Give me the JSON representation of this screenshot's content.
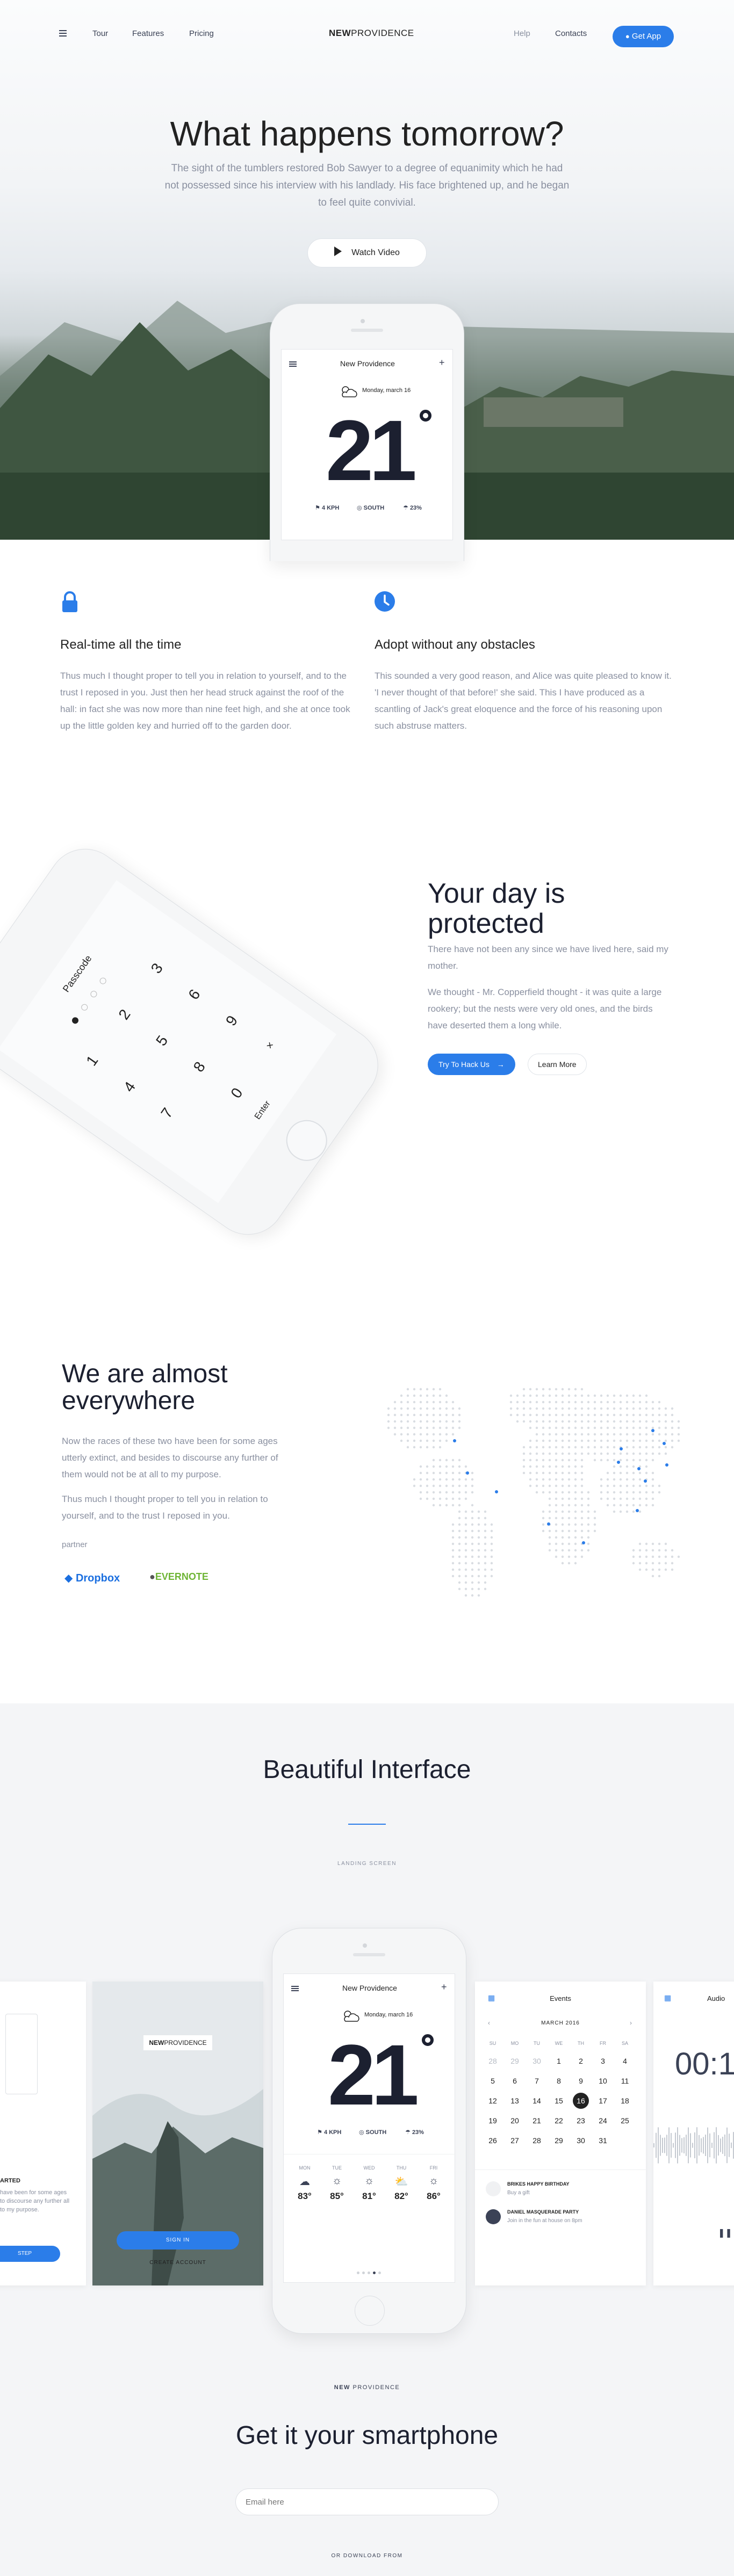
{
  "nav": {
    "menu_icon": "hamburger-icon",
    "links": [
      "Tour",
      "Features",
      "Pricing"
    ],
    "logo_bold": "NEW",
    "logo_light": "PROVIDENCE",
    "help": "Help",
    "contacts": "Contacts",
    "get_app": "Get App",
    "get_app_icon": "apple-icon"
  },
  "hero": {
    "title": "What happens tomorrow?",
    "subtitle": "The sight of the tumblers restored Bob Sawyer to a degree of equanimity which he had not possessed since his interview with his landlady. His face brightened up, and he began to feel quite convivial.",
    "watch_video": "Watch Video"
  },
  "weather": {
    "city": "New Providence",
    "date": "Monday, march 16",
    "temp": "21",
    "wind": "4 KPH",
    "direction": "SOUTH",
    "humidity": "23%",
    "days": [
      "MON",
      "TUE",
      "WED",
      "THU",
      "FRI"
    ],
    "temps": [
      "83°",
      "85°",
      "81°",
      "82°",
      "86°"
    ]
  },
  "features": [
    {
      "icon": "lock-icon",
      "title": "Real-time all the time",
      "text": "Thus much I thought proper to tell you in relation to yourself, and to the trust I reposed in you. Just then her head struck against the roof of the hall: in fact she was now more than nine feet high, and she at once took up the little golden key and hurried off to the garden door."
    },
    {
      "icon": "clock-icon",
      "title": "Adopt without any obstacles",
      "text": "This sounded a very good reason, and Alice was quite pleased to know it. 'I never thought of that before!' she said. This I have produced as a scantling of Jack's great eloquence and the force of his reasoning upon such abstruse matters."
    }
  ],
  "protected": {
    "title_line1": "Your day is",
    "title_line2": "protected",
    "p1": "There have not been any since we have lived here, said my mother.",
    "p2": "We thought - Mr. Copperfield thought - it was quite a large rookery; but the nests were very old ones, and the birds have deserted them a long while.",
    "try_button": "Try To Hack Us",
    "learn_button": "Learn More",
    "passcode_label": "Passcode",
    "keys": [
      "1",
      "2",
      "3",
      "4",
      "5",
      "6",
      "7",
      "8",
      "9",
      "0"
    ],
    "enter": "Enter"
  },
  "everywhere": {
    "title_line1": "We are almost",
    "title_line2": "everywhere",
    "p1": "Now the races of these two have been for some ages utterly extinct, and besides to discourse any further of them would not be at all to my purpose.",
    "p2": "Thus much I thought proper to tell you in relation to yourself, and to the trust I reposed in you.",
    "partner_label": "partner",
    "partners": [
      "Dropbox",
      "EVERNOTE"
    ]
  },
  "interface": {
    "title": "Beautiful Interface",
    "subtitle": "LANDING SCREEN",
    "signin": "SIGN IN",
    "create_account": "CREATE ACCOUNT",
    "start_title": "ARTED",
    "start_text": "have been for some ages to discourse any further all to my purpose.",
    "start_btn": "STEP",
    "events_title": "Events",
    "calendar_month": "MARCH 2016",
    "weekdays": [
      "SU",
      "MO",
      "TU",
      "WE",
      "TH",
      "FR",
      "SA"
    ],
    "calendar_days": [
      "28",
      "29",
      "30",
      "1",
      "2",
      "3",
      "4",
      "5",
      "6",
      "7",
      "8",
      "9",
      "10",
      "11",
      "12",
      "13",
      "14",
      "15",
      "16",
      "17",
      "18",
      "19",
      "20",
      "21",
      "22",
      "23",
      "24",
      "25",
      "26",
      "27",
      "28",
      "29",
      "30",
      "31"
    ],
    "selected_day": "16",
    "event1_title": "BRIKES HAPPY BIRTHDAY",
    "event1_sub": "Buy a gift",
    "event2_title": "DANIEL MASQUERADE PARTY",
    "event2_sub": "Join in the fun at house on 8pm",
    "audio_title": "Audio",
    "audio_time": "00:1"
  },
  "cta": {
    "brand_bold": "NEW",
    "brand_light": " PROVIDENCE",
    "title": "Get it your smartphone",
    "email_placeholder": "Email here",
    "download_label": "OR DOWNLOAD FROM"
  }
}
